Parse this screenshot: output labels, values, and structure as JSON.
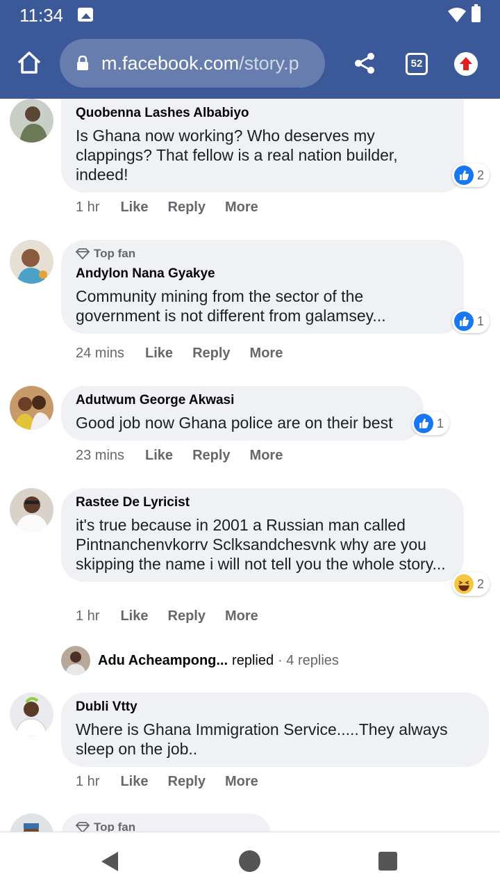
{
  "status_bar": {
    "time": "11:34"
  },
  "browser": {
    "url_domain": "m.facebook.com",
    "url_path": "/story.p",
    "tab_count": "52",
    "icons": [
      "home-icon",
      "lock-icon",
      "share-icon",
      "tabs-icon",
      "update-icon"
    ]
  },
  "colors": {
    "header": "#3b5998",
    "bubble": "#eff1f4",
    "like": "#1877f2",
    "haha": "#f7c640",
    "meta": "#65676b"
  },
  "comments": [
    {
      "author": "Quobenna Lashes Albabiyo",
      "top_fan": false,
      "text": "Is Ghana now working? Who deserves my clappings? That fellow is a real nation builder, indeed!",
      "reaction": "like",
      "reaction_count": "2",
      "time": "1 hr",
      "like": "Like",
      "reply": "Reply",
      "more": "More"
    },
    {
      "author": "Andylon Nana Gyakye",
      "top_fan": true,
      "top_fan_label": "Top fan",
      "text": "Community mining from the sector of the government is not different from galamsey...",
      "reaction": "like",
      "reaction_count": "1",
      "time": "24 mins",
      "like": "Like",
      "reply": "Reply",
      "more": "More"
    },
    {
      "author": "Adutwum George Akwasi",
      "top_fan": false,
      "text": "Good job now Ghana police are on their best",
      "reaction": "like",
      "reaction_count": "1",
      "time": "23 mins",
      "like": "Like",
      "reply": "Reply",
      "more": "More"
    },
    {
      "author": "Rastee De Lyricist",
      "top_fan": false,
      "text": "it's true because in 2001 a Russian man called Pintnanchenvkorrv Sclksandchesvnk why are you skipping the name i will not tell you the whole story...",
      "reaction": "haha",
      "reaction_count": "2",
      "time": "1 hr",
      "like": "Like",
      "reply": "Reply",
      "more": "More"
    },
    {
      "author": "Dubli Vtty",
      "top_fan": false,
      "text": "Where is Ghana Immigration Service.....They always sleep on the job..",
      "time": "1 hr",
      "like": "Like",
      "reply": "Reply",
      "more": "More"
    }
  ],
  "reply_preview": {
    "name": "Adu Acheampong...",
    "action": "replied",
    "count": "· 4 replies"
  },
  "partial_comment": {
    "top_fan_label": "Top fan"
  }
}
